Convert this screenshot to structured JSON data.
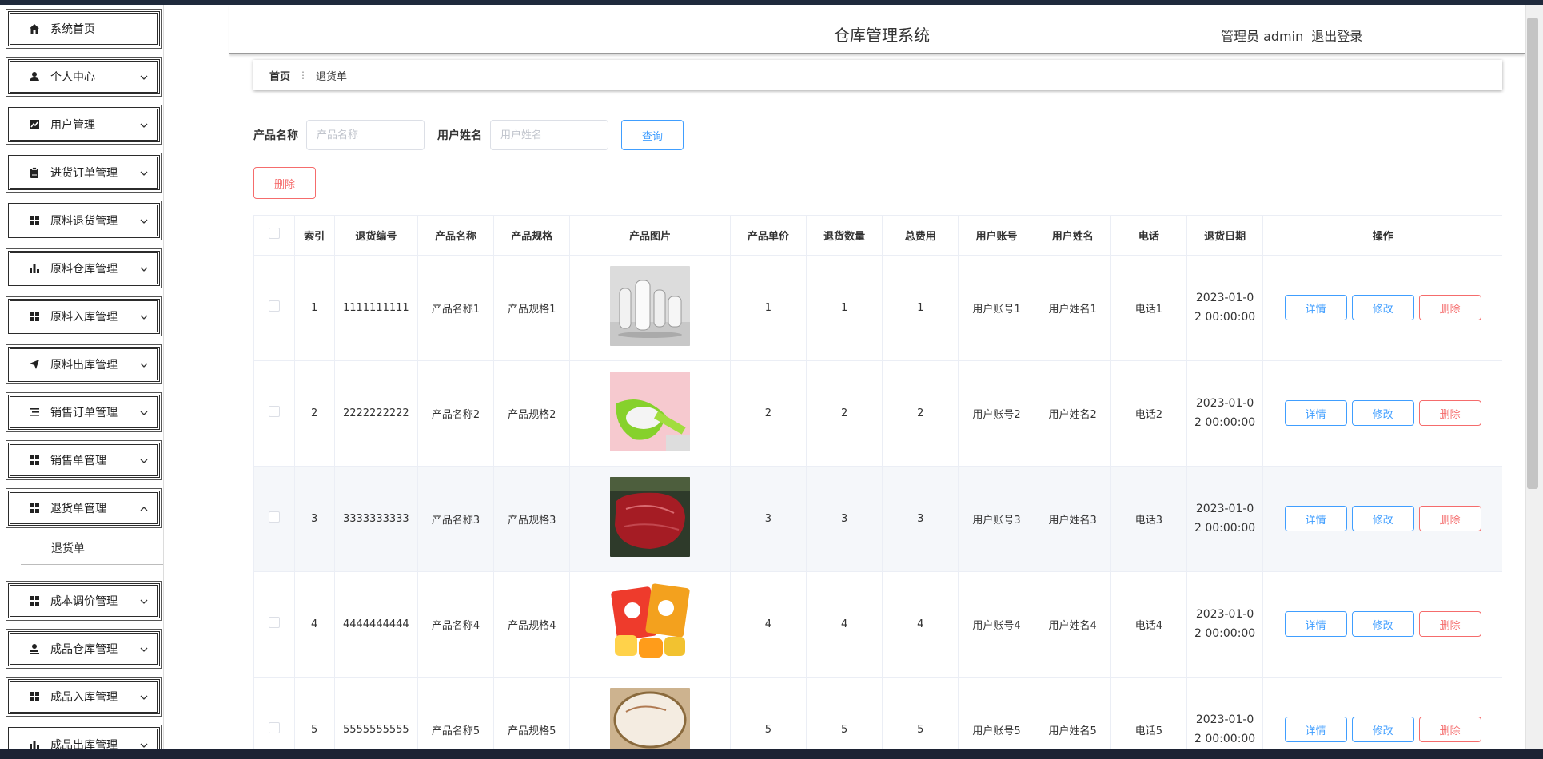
{
  "app": {
    "title": "仓库管理系统"
  },
  "user": {
    "role_name": "管理员 admin",
    "logout_label": "退出登录"
  },
  "breadcrumb": {
    "home": "首页",
    "current": "退货单"
  },
  "sidebar": {
    "items": [
      {
        "label": "系统首页",
        "icon": "home-icon",
        "has_children": false
      },
      {
        "label": "个人中心",
        "icon": "user-icon",
        "has_children": true
      },
      {
        "label": "用户管理",
        "icon": "chart-icon",
        "has_children": true
      },
      {
        "label": "进货订单管理",
        "icon": "clipboard-icon",
        "has_children": true
      },
      {
        "label": "原料退货管理",
        "icon": "grid-icon",
        "has_children": true
      },
      {
        "label": "原料仓库管理",
        "icon": "bar-chart-icon",
        "has_children": true
      },
      {
        "label": "原料入库管理",
        "icon": "grid-icon",
        "has_children": true
      },
      {
        "label": "原料出库管理",
        "icon": "send-icon",
        "has_children": true
      },
      {
        "label": "销售订单管理",
        "icon": "list-icon",
        "has_children": true
      },
      {
        "label": "销售单管理",
        "icon": "grid-icon",
        "has_children": true
      },
      {
        "label": "退货单管理",
        "icon": "grid-icon",
        "has_children": true,
        "expanded": true
      },
      {
        "label": "成本调价管理",
        "icon": "grid-icon",
        "has_children": true
      },
      {
        "label": "成品仓库管理",
        "icon": "person-stamp-icon",
        "has_children": true
      },
      {
        "label": "成品入库管理",
        "icon": "grid-icon",
        "has_children": true
      },
      {
        "label": "成品出库管理",
        "icon": "bar-chart-icon",
        "has_children": true
      }
    ],
    "submenu_label": "退货单"
  },
  "search": {
    "product_name_label": "产品名称",
    "product_name_placeholder": "产品名称",
    "user_name_label": "用户姓名",
    "user_name_placeholder": "用户姓名",
    "query_label": "查询",
    "delete_label": "删除"
  },
  "table": {
    "headers": [
      "索引",
      "退货编号",
      "产品名称",
      "产品规格",
      "产品图片",
      "产品单价",
      "退货数量",
      "总费用",
      "用户账号",
      "用户姓名",
      "电话",
      "退货日期",
      "操作"
    ],
    "action_labels": {
      "detail": "详情",
      "edit": "修改",
      "delete": "删除"
    },
    "rows": [
      {
        "index": "1",
        "code": "1111111111",
        "product": "产品名称1",
        "spec": "产品规格1",
        "image": "appliances-image",
        "price": "1",
        "qty": "1",
        "total": "1",
        "account": "用户账号1",
        "name": "用户姓名1",
        "phone": "电话1",
        "date_line1": "2023-01-0",
        "date_line2": "2 00:00:00"
      },
      {
        "index": "2",
        "code": "2222222222",
        "product": "产品名称2",
        "spec": "产品规格2",
        "image": "green-scoop-image",
        "price": "2",
        "qty": "2",
        "total": "2",
        "account": "用户账号2",
        "name": "用户姓名2",
        "phone": "电话2",
        "date_line1": "2023-01-0",
        "date_line2": "2 00:00:00"
      },
      {
        "index": "3",
        "code": "3333333333",
        "product": "产品名称3",
        "spec": "产品规格3",
        "image": "beef-image",
        "price": "3",
        "qty": "3",
        "total": "3",
        "account": "用户账号3",
        "name": "用户姓名3",
        "phone": "电话3",
        "date_line1": "2023-01-0",
        "date_line2": "2 00:00:00"
      },
      {
        "index": "4",
        "code": "4444444444",
        "product": "产品名称4",
        "spec": "产品规格4",
        "image": "jelly-snack-image",
        "price": "4",
        "qty": "4",
        "total": "4",
        "account": "用户账号4",
        "name": "用户姓名4",
        "phone": "电话4",
        "date_line1": "2023-01-0",
        "date_line2": "2 00:00:00"
      },
      {
        "index": "5",
        "code": "5555555555",
        "product": "产品名称5",
        "spec": "产品规格5",
        "image": "ceiling-lamp-image",
        "price": "5",
        "qty": "5",
        "total": "5",
        "account": "用户账号5",
        "name": "用户姓名5",
        "phone": "电话5",
        "date_line1": "2023-01-0",
        "date_line2": "2 00:00:00"
      }
    ]
  },
  "colors": {
    "primary": "#409eff",
    "danger": "#f56c6c",
    "border": "#ebeef5",
    "hover_row": "#f5f7fa"
  }
}
